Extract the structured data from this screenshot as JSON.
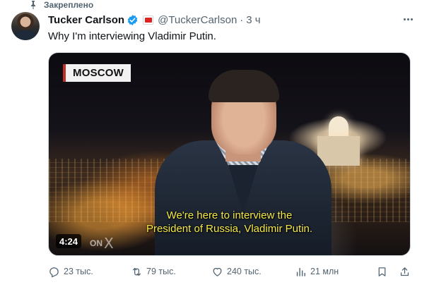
{
  "pinned": {
    "label": "Закреплено",
    "icon": "pin-icon"
  },
  "author": {
    "name": "Tucker Carlson",
    "handle": "@TuckerCarlson",
    "separator": "·",
    "time": "3 ч",
    "verified_color": "#1d9bf0"
  },
  "tweet": {
    "text": "Why I'm interviewing Vladimir Putin."
  },
  "media": {
    "location_tag": "MOSCOW",
    "subtitle_line1": "We're here to interview the",
    "subtitle_line2": "President of Russia, Vladimir Putin.",
    "duration": "4:24",
    "watermark": "ON",
    "watermark_x": "X"
  },
  "actions": {
    "replies": "23 тыс.",
    "retweets": "79 тыс.",
    "likes": "240 тыс.",
    "views": "21 млн"
  },
  "colors": {
    "text_secondary": "#536471",
    "subtitle_yellow": "#f5e94a",
    "accent": "#1d9bf0"
  }
}
